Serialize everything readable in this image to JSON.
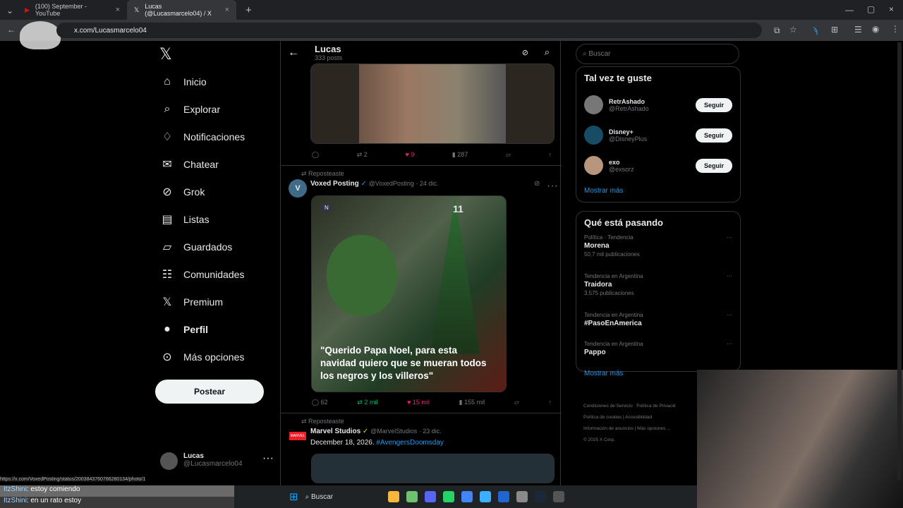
{
  "browser": {
    "tabs": [
      {
        "label": "(100) September - YouTube"
      },
      {
        "label": "Lucas (@Lucasmarcelo04) / X"
      }
    ],
    "url": "x.com/Lucasmarcelo04",
    "status_url": "https://x.com/VoxedPosting/status/2003843760766280134/photo/1"
  },
  "sidebar": {
    "items": [
      {
        "label": "Inicio"
      },
      {
        "label": "Explorar"
      },
      {
        "label": "Notificaciones"
      },
      {
        "label": "Chatear"
      },
      {
        "label": "Grok"
      },
      {
        "label": "Listas"
      },
      {
        "label": "Guardados"
      },
      {
        "label": "Comunidades"
      },
      {
        "label": "Premium"
      },
      {
        "label": "Perfil"
      },
      {
        "label": "Más opciones"
      }
    ],
    "post_label": "Postear",
    "profile": {
      "name": "Lucas",
      "handle": "@Lucasmarcelo04"
    }
  },
  "profile_header": {
    "name": "Lucas",
    "posts": "333 posts"
  },
  "first_tweet": {
    "replies": "",
    "reposts": "2",
    "likes": "9",
    "views": "287"
  },
  "tweet": {
    "repost_label": "Reposteaste",
    "author": "Voxed Posting",
    "handle": "@VoxedPosting · 24 dic.",
    "image_count": "11",
    "caption": "\"Querido Papa Noel, para esta navidad quiero que se mueran todos los negros y los villeros\"",
    "replies": "62",
    "reposts": "2 mil",
    "likes": "15 mil",
    "views": "155 mil"
  },
  "tweet2": {
    "repost_label": "Reposteaste",
    "author": "Marvel Studios",
    "handle": "@MarvelStudios · 23 dic.",
    "text": "December 18, 2026.",
    "hashtag": "#AvengersDoomsday"
  },
  "search": {
    "placeholder": "Buscar"
  },
  "suggestions": {
    "title": "Tal vez te guste",
    "follow": "Seguir",
    "more": "Mostrar más",
    "accounts": [
      {
        "name": "RetrAshado",
        "handle": "@RetrAshado"
      },
      {
        "name": "Disney+",
        "handle": "@DisneyPlus"
      },
      {
        "name": "exo",
        "handle": "@exsorz"
      }
    ]
  },
  "trends": {
    "title": "Qué está pasando",
    "more": "Mostrar más",
    "items": [
      {
        "context": "Política · Tendencia",
        "name": "Morena",
        "count": "50,7 mil publicaciones"
      },
      {
        "context": "Tendencia en Argentina",
        "name": "Traidora",
        "count": "3.575 publicaciones"
      },
      {
        "context": "Tendencia en Argentina",
        "name": "#PasoEnAmerica",
        "count": ""
      },
      {
        "context": "Tendencia en Argentina",
        "name": "Pappo",
        "count": ""
      }
    ]
  },
  "footer": [
    "Condiciones de Servicio",
    "Política de Privacid",
    "Política de cookies",
    "Accesibilidad",
    "Información de anuncios",
    "Más opciones ...",
    "© 2025 X Corp."
  ],
  "chat": [
    {
      "user": "ItzShini",
      "msg": ": estoy comiendo"
    },
    {
      "user": "ItzShini",
      "msg": ": en un rato estoy"
    }
  ],
  "taskbar": {
    "search": "Buscar"
  }
}
